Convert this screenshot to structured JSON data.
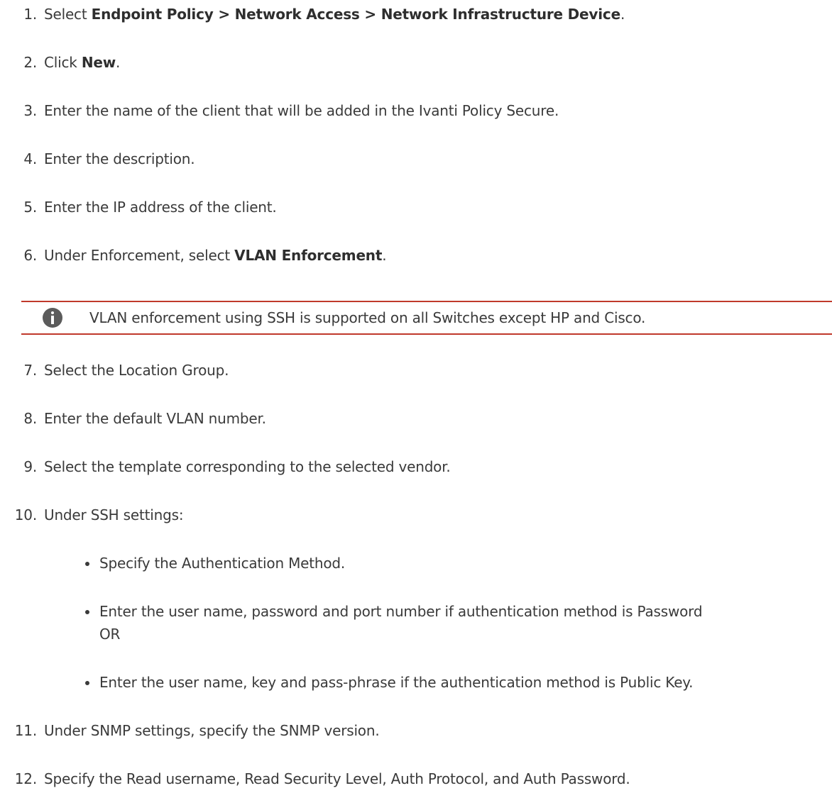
{
  "steps": [
    {
      "num": "1.",
      "pre": "Select ",
      "bold": "Endpoint Policy > Network Access > Network Infrastructure Device",
      "post": "."
    },
    {
      "num": "2.",
      "pre": "Click ",
      "bold": "New",
      "post": "."
    },
    {
      "num": "3.",
      "text": "Enter the name of the client that will be added in the Ivanti Policy Secure."
    },
    {
      "num": "4.",
      "text": "Enter the description."
    },
    {
      "num": "5.",
      "text": "Enter the IP address of the client."
    },
    {
      "num": "6.",
      "pre": "Under Enforcement, select ",
      "bold": "VLAN Enforcement",
      "post": "."
    },
    {
      "num": "7.",
      "text": "Select the Location Group."
    },
    {
      "num": "8.",
      "text": "Enter the default VLAN number."
    },
    {
      "num": "9.",
      "text": "Select the template corresponding to the selected vendor."
    },
    {
      "num": "10.",
      "text": "Under SSH settings:"
    },
    {
      "num": "11.",
      "text": "Under SNMP settings, specify the SNMP version."
    },
    {
      "num": "12.",
      "text": "Specify the Read username, Read Security Level, Auth Protocol, and Auth Password."
    }
  ],
  "note": {
    "icon": "info-icon",
    "text": "VLAN enforcement using SSH is supported on all Switches except HP and Cisco.",
    "border_color": "#c0392b"
  },
  "ssh_bullets": [
    {
      "text": "Specify the Authentication Method."
    },
    {
      "text": "Enter the user name, password and port number if authentication method is Password",
      "cont": "OR"
    },
    {
      "text": "Enter the user name, key and pass-phrase if the authentication method is Public Key."
    }
  ]
}
